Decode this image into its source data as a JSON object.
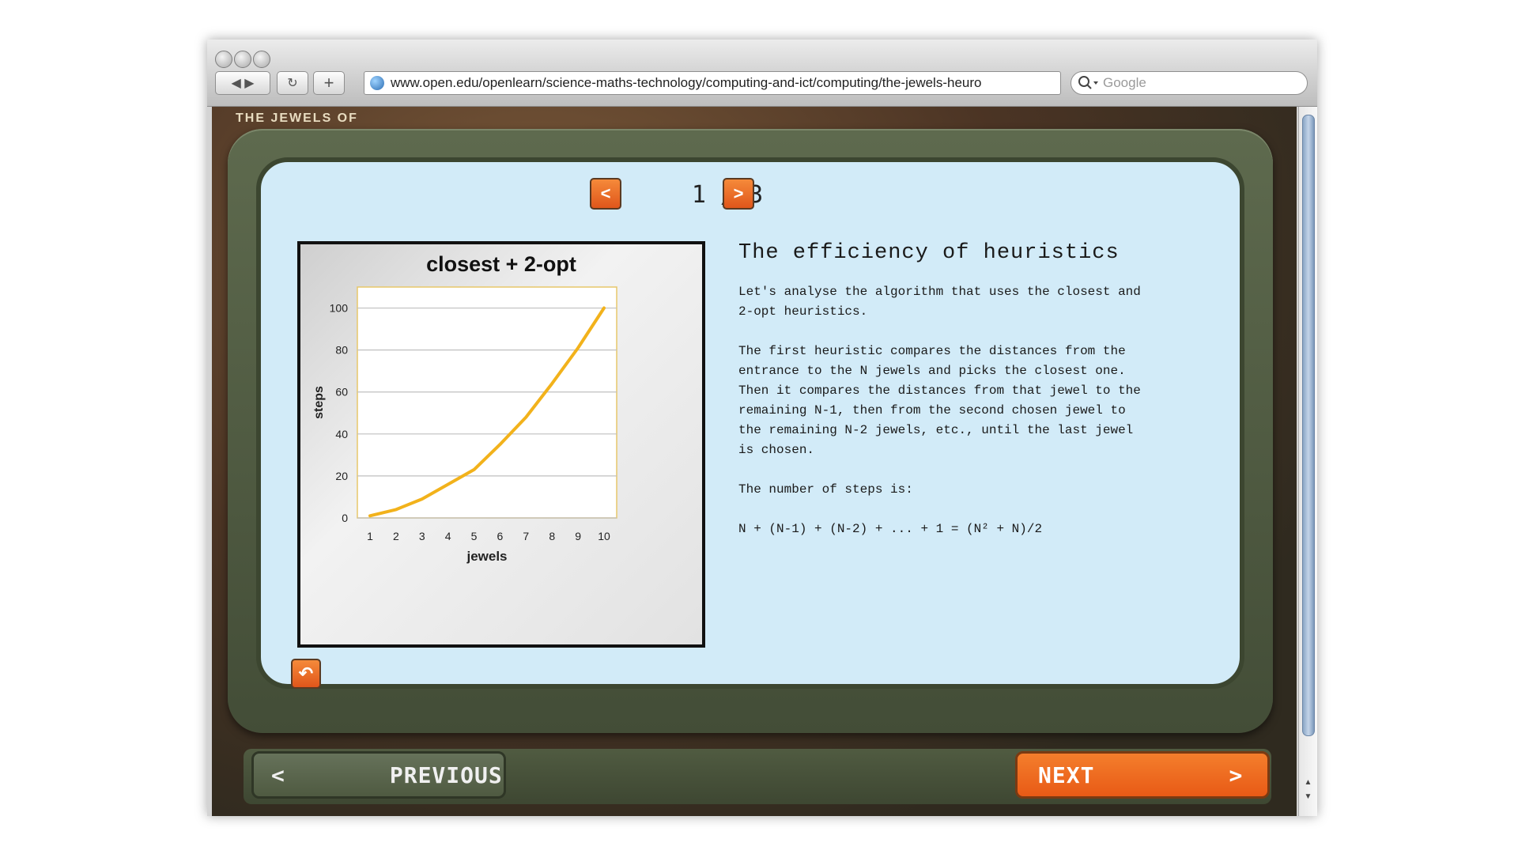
{
  "browser": {
    "url": "www.open.edu/openlearn/science-maths-technology/computing-and-ict/computing/the-jewels-heuro",
    "search_placeholder": "Google",
    "back_glyph": "◀ ▶",
    "reload_glyph": "↻",
    "newtab_glyph": "+"
  },
  "game": {
    "title_fragment": "THE JEWELS OF"
  },
  "slide": {
    "page_current": "1",
    "page_total": "3",
    "pager_text": "1 / 3",
    "prev_glyph": "<",
    "next_glyph": ">",
    "reset_glyph": "↶",
    "heading": "The efficiency of heuristics",
    "paragraphs": [
      "Let's analyse the algorithm that uses the closest and\n2-opt heuristics.",
      "The first heuristic compares the distances from the\nentrance to the N jewels and picks the closest one.\nThen it compares the distances from that jewel to the\nremaining N-1, then from the second chosen jewel to\nthe remaining N-2 jewels, etc., until the last jewel\nis chosen.",
      "The number of steps is:",
      "N + (N-1) + (N-2) + ... + 1 = (N² + N)/2"
    ]
  },
  "nav": {
    "previous_label": "PREVIOUS",
    "next_label": "NEXT",
    "previous_arrow": "<",
    "next_arrow": ">"
  },
  "chart_data": {
    "type": "line",
    "title": "closest + 2-opt",
    "xlabel": "jewels",
    "ylabel": "steps",
    "x": [
      1,
      2,
      3,
      4,
      5,
      6,
      7,
      8,
      9,
      10
    ],
    "series": [
      {
        "values": [
          1,
          4,
          9,
          16,
          23,
          35,
          48,
          64,
          81,
          100
        ],
        "color": "#f2b21b"
      }
    ],
    "xlim": [
      1,
      10
    ],
    "ylim": [
      0,
      110
    ],
    "yticks": [
      0,
      20,
      40,
      60,
      80,
      100
    ],
    "grid": true
  },
  "colors": {
    "accent_orange": "#e8641f",
    "screen_bg": "#d2ebf8",
    "frame_green": "#4b5640"
  }
}
